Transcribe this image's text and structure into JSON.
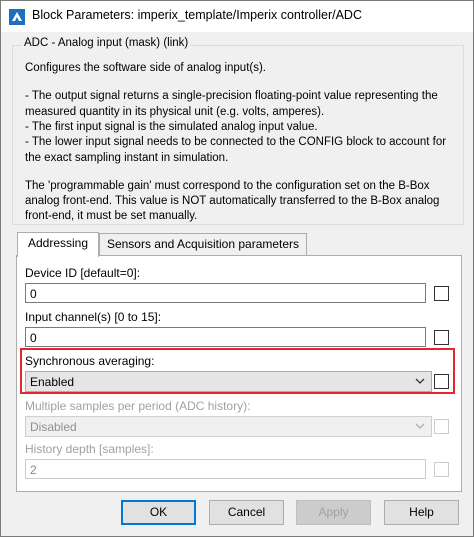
{
  "window": {
    "title": "Block Parameters: imperix_template/Imperix controller/ADC",
    "icon": "matlab-block-icon"
  },
  "group": {
    "title": "ADC - Analog input (mask) (link)",
    "description_lines": [
      "Configures the software side of analog input(s).",
      "",
      "- The output signal returns a single-precision floating-point value representing the",
      "measured quantity in its physical unit (e.g. volts, amperes).",
      "- The first input signal is the simulated analog input value.",
      "- The lower input signal needs to be connected to the CONFIG block to account for",
      "the exact sampling instant in simulation.",
      "",
      "The 'programmable gain' must correspond to the configuration set on the B-Box",
      "analog front-end. This value is NOT automatically transferred to the B-Box analog",
      "front-end, it must be set manually."
    ]
  },
  "tabs": [
    {
      "label": "Addressing",
      "active": true
    },
    {
      "label": "Sensors and Acquisition parameters",
      "active": false
    }
  ],
  "params": {
    "device_id": {
      "label": "Device ID [default=0]:",
      "value": "0"
    },
    "input_channel": {
      "label": "Input channel(s) [0 to 15]:",
      "value": "0"
    },
    "sync_avg": {
      "label": "Synchronous averaging:",
      "value": "Enabled"
    },
    "samples_per_period": {
      "label": "Multiple samples per period (ADC history):",
      "value": "Disabled"
    },
    "history_depth": {
      "label": "History depth [samples]:",
      "value": "2"
    }
  },
  "buttons": {
    "ok": "OK",
    "cancel": "Cancel",
    "apply": "Apply",
    "help": "Help"
  },
  "colors": {
    "highlight": "#e0282e",
    "focus": "#0078d7"
  }
}
